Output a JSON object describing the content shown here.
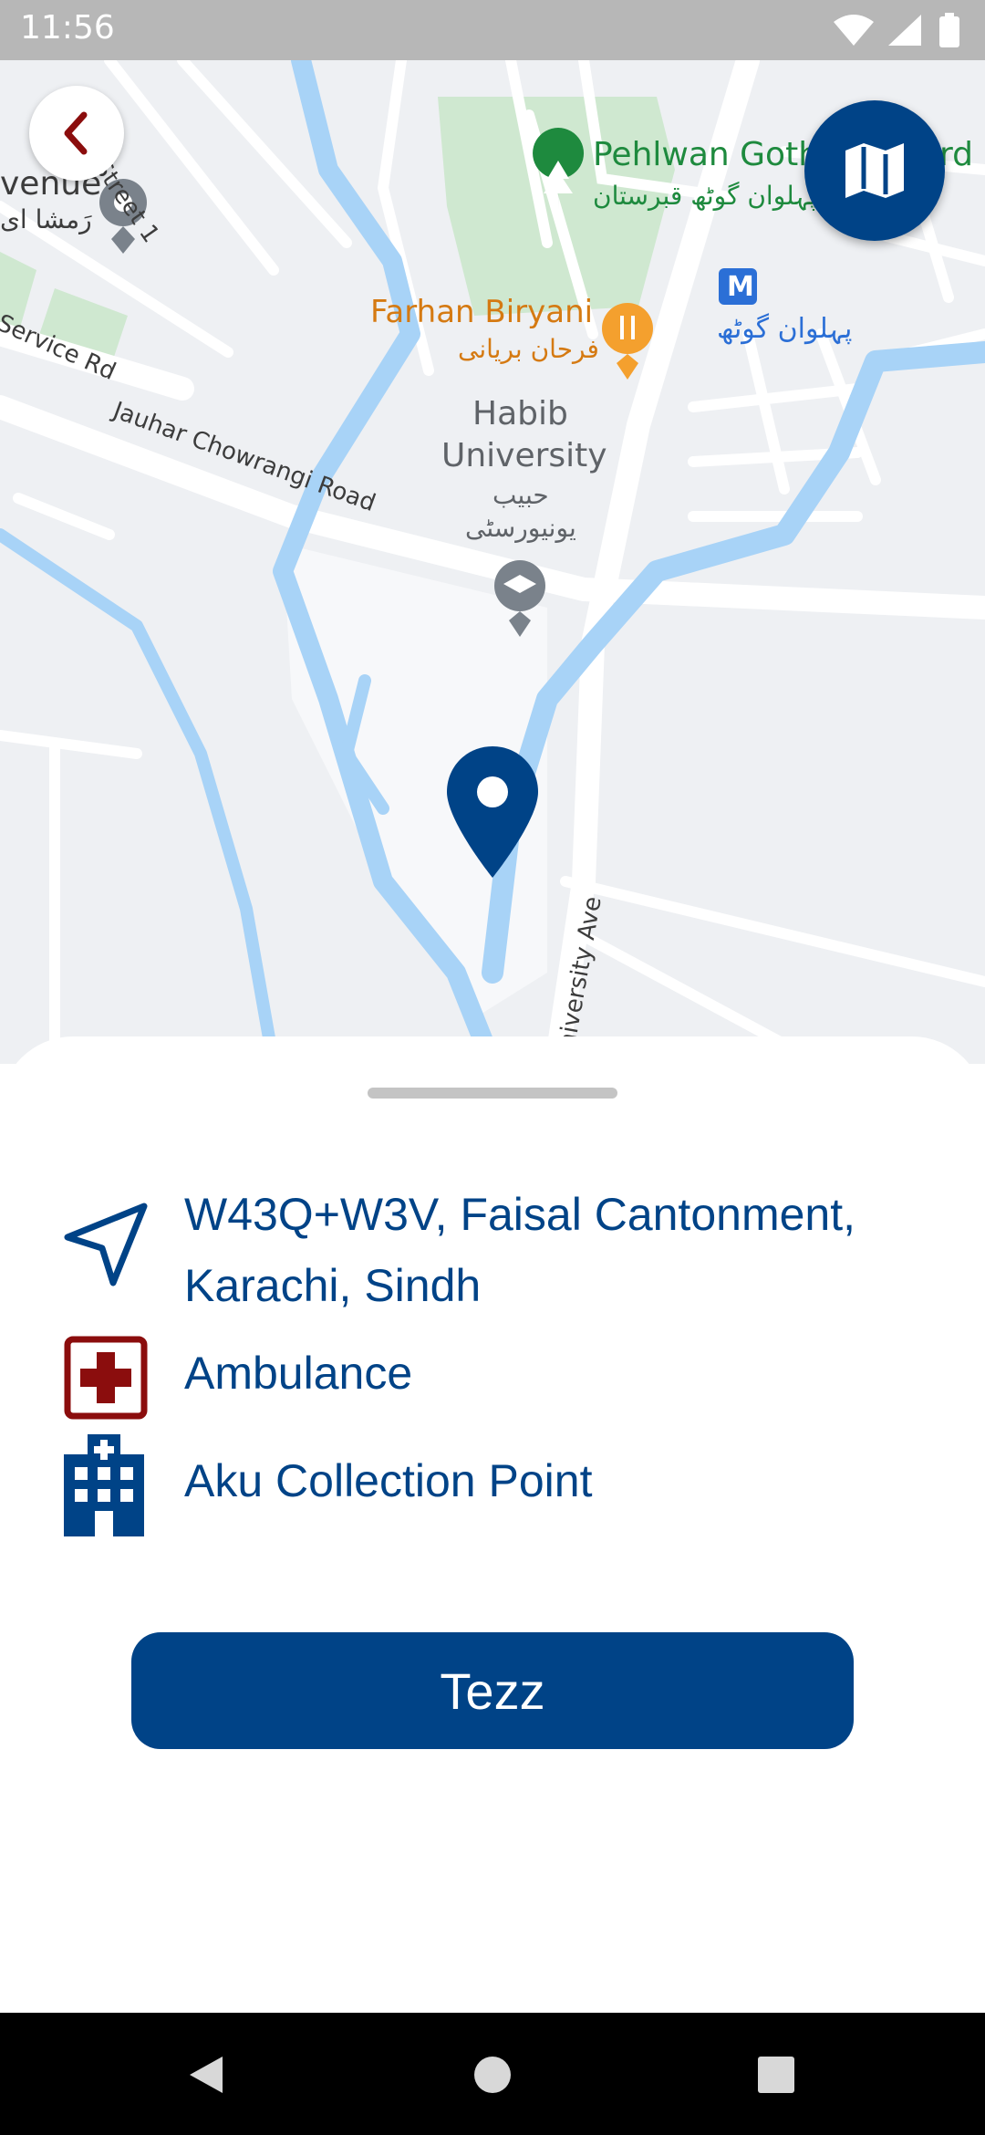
{
  "status_bar": {
    "time": "11:56",
    "icons": [
      "wifi-icon",
      "cell-signal-icon",
      "battery-icon"
    ]
  },
  "map": {
    "labels": {
      "pehlwan_goth_en": "Pehlwan Goth",
      "pehlwan_goth_suffix": "rd",
      "pehlwan_goth_ur": "پہلوان گوٹھ قبرستان",
      "farhan_en": "Farhan Biryani",
      "farhan_ur": "فرحان بریانی",
      "metro_ur": "پہلوان گوٹھ",
      "habib_line1": "Habib",
      "habib_line2": "University",
      "habib_ur1": "حبیب",
      "habib_ur2": "یونیورسٹی",
      "avenue_en": "venue",
      "avenue_ur": "رَمشا ای",
      "street": "Street 1",
      "service_rd": "Service Rd",
      "jauhar": "Jauhar Chowrangi Road",
      "university_ave": "niversity Ave"
    },
    "metro_badge": "M"
  },
  "sheet": {
    "address": "W43Q+W3V, Faisal Cantonment, Karachi, Sindh",
    "service_type": "Ambulance",
    "facility": "Aku Collection Point",
    "cta_label": "Tezz"
  },
  "colors": {
    "primary": "#004387",
    "accent_red": "#8b0d0d",
    "map_bg": "#eef0f3",
    "water": "#a8d3f7",
    "park": "#c8e6c9"
  }
}
